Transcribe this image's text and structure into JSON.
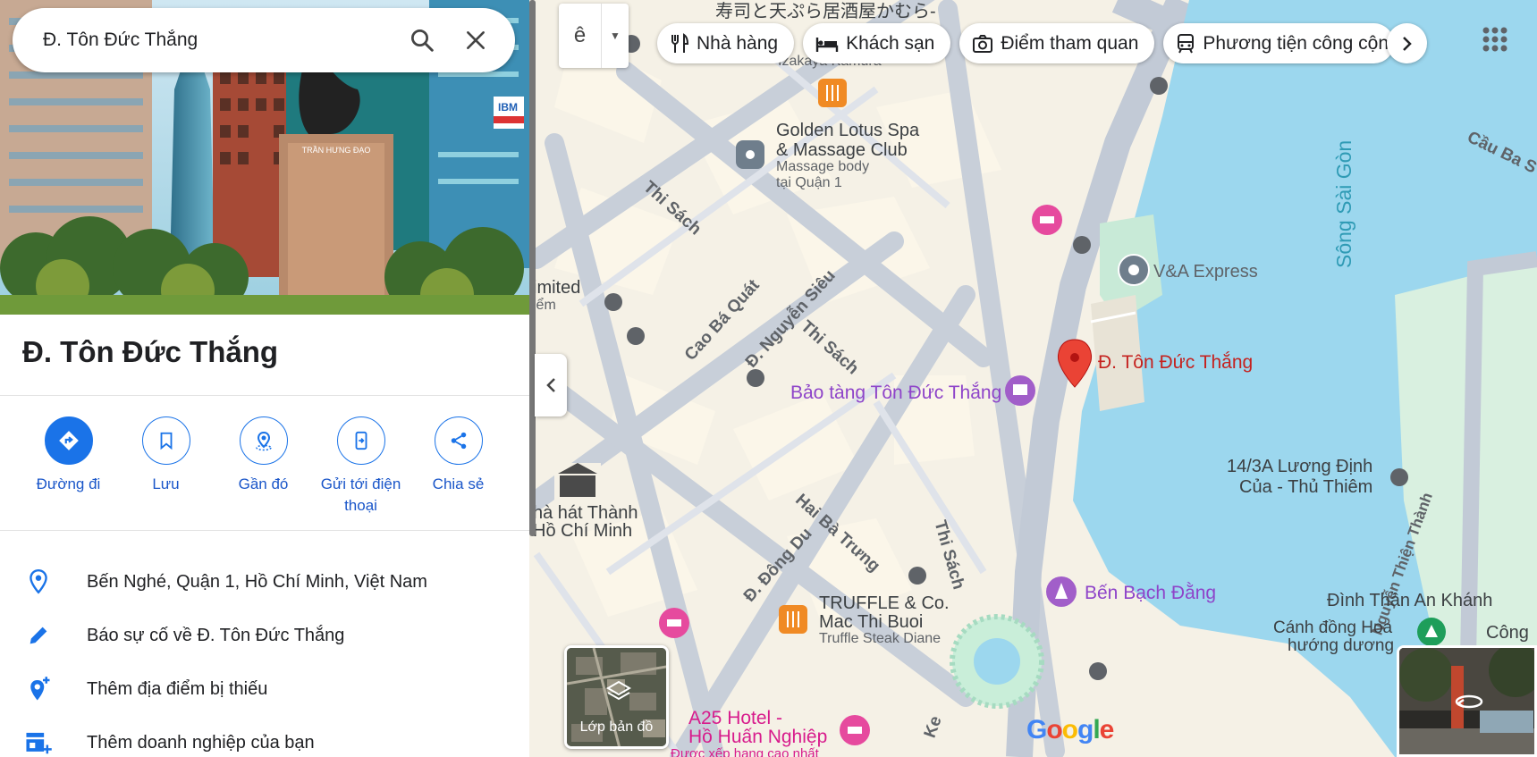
{
  "search": {
    "value": "Đ. Tôn Đức Thắng"
  },
  "place": {
    "title": "Đ. Tôn Đức Thắng",
    "hero_statue_text": "TRẦN HƯNG ĐẠO",
    "hero_sign_text": "IBM"
  },
  "actions": [
    {
      "label": "Đường đi",
      "icon": "directions-icon"
    },
    {
      "label": "Lưu",
      "icon": "bookmark-icon"
    },
    {
      "label": "Gần đó",
      "icon": "nearby-icon"
    },
    {
      "label": "Gửi tới điện thoại",
      "icon": "send-to-phone-icon"
    },
    {
      "label": "Chia sẻ",
      "icon": "share-icon"
    }
  ],
  "info": {
    "address": "Bến Nghé, Quận 1, Hồ Chí Minh, Việt Nam",
    "report": "Báo sự cố về Đ. Tôn Đức Thắng",
    "add_place": "Thêm địa điểm bị thiếu",
    "add_business": "Thêm doanh nghiệp của bạn"
  },
  "toolbar": {
    "lang_label": "ê",
    "chips": [
      "Nhà hàng",
      "Khách sạn",
      "Điểm tham quan",
      "Phương tiện công cộng"
    ]
  },
  "map_labels": {
    "restaurant_jp": "寿司と天ぷら居酒屋かむら-",
    "izakaya": "Izakaya Kamura",
    "golden_lotus_1": "Golden Lotus Spa",
    "golden_lotus_2": "& Massage Club",
    "golden_lotus_sub_1": "Massage body",
    "golden_lotus_sub_2": "tại Quận 1",
    "thi_sach_1": "Thi Sách",
    "thi_sach_2": "Thi Sách",
    "thi_sach_3": "Thi Sách",
    "cao_ba_quat": "Cao Bá Quát",
    "nguyen_sieu": "Đ. Nguyễn Siêu",
    "hai_ba_trung": "Hai Bà Trưng",
    "dong_du": "Đ. Đông Du",
    "limited": "imited",
    "limited_2": "iểm",
    "va_express": "V&A Express",
    "song_sai_gon": "Sông Sài Gòn",
    "cau_ba_son": "Cầu Ba S",
    "selected_place": "Đ. Tôn Đức Thắng",
    "museum": "Bảo tàng Tôn Đức Thắng",
    "luong_dinh_cua_1": "14/3A Lương Định",
    "luong_dinh_cua_2": "Của - Thủ Thiêm",
    "opera_1": "hà hát Thành",
    "opera_2": "Hồ Chí Minh",
    "ben_bach_dang": "Bến Bạch Đằng",
    "truffle_1": "TRUFFLE & Co.",
    "truffle_2": "Mac Thi Buoi",
    "truffle_sub": "Truffle Steak Diane",
    "dinh_than": "Đình Thần An Khánh",
    "canh_dong_1": "Cánh đồng Hoa",
    "canh_dong_2": "hướng dương",
    "cong": "Công",
    "nguyen_thien_thanh": "Nguyễn Thiện Thành",
    "a25_1": "A25 Hotel -",
    "a25_2": "Hồ Huấn Nghiệp",
    "a25_sub": "Được xếp hạng cao nhất",
    "ke": "Ke"
  },
  "layers_label": "Lớp bản đồ",
  "google_logo": [
    "G",
    "o",
    "o",
    "g",
    "l",
    "e"
  ],
  "colors": {
    "accent": "#1a73e8",
    "water": "#9cd7ee",
    "land": "#f3efe4",
    "road": "#c5cdd8",
    "pin": "#ea4335",
    "museum_purple": "#a15ec9",
    "hotel_pink": "#e64a9e",
    "restaurant_orange": "#f08a24"
  }
}
